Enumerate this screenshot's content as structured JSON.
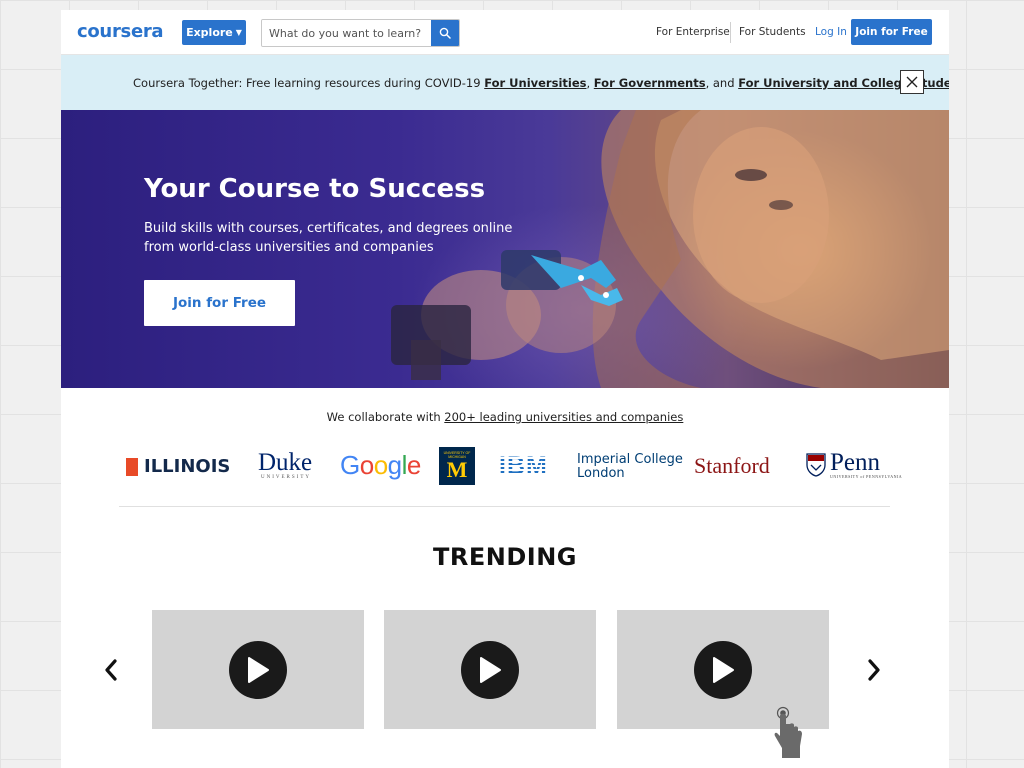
{
  "header": {
    "logo": "coursera",
    "explore_label": "Explore",
    "search_placeholder": "What do you want to learn?",
    "for_enterprise": "For Enterprise",
    "for_students": "For Students",
    "login": "Log In",
    "join": "Join for Free"
  },
  "banner": {
    "prefix": "Coursera Together: Free learning resources during COVID-19 ",
    "link_universities": "For Universities",
    "sep1": ", ",
    "link_governments": "For Governments",
    "sep2": ", and ",
    "link_students": "For University and College Students"
  },
  "hero": {
    "title": "Your Course to Success",
    "subtitle_line1": "Build skills with courses, certificates, and degrees online",
    "subtitle_line2": "from world-class universities and companies",
    "cta": "Join for Free"
  },
  "partners": {
    "prefix": "We collaborate with ",
    "link": "200+ leading universities and companies",
    "illinois": "ILLINOIS",
    "duke": "Duke",
    "duke_sub": "UNIVERSITY",
    "google_letters": [
      "G",
      "o",
      "o",
      "g",
      "l",
      "e"
    ],
    "google_colors": [
      "#4285F4",
      "#EA4335",
      "#FBBC05",
      "#4285F4",
      "#34A853",
      "#EA4335"
    ],
    "michigan": "M",
    "michigan_sub": "UNIVERSITY OF MICHIGAN",
    "ibm": "IBM",
    "imperial_line1": "Imperial College",
    "imperial_line2": "London",
    "stanford": "Stanford",
    "penn": "Penn",
    "penn_sub": "UNIVERSITY of PENNSYLVANIA"
  },
  "trending": {
    "title": "TRENDING",
    "card_count_visible": 3
  },
  "colors": {
    "brand_blue": "#2a73cc",
    "banner_bg": "#d9eef6",
    "card_bg": "#d3d3d3"
  },
  "icons": {
    "search": "search-icon",
    "close": "close-icon",
    "prev": "chevron-left-icon",
    "next": "chevron-right-icon",
    "play": "play-icon",
    "cursor": "hand-pointer-icon"
  }
}
